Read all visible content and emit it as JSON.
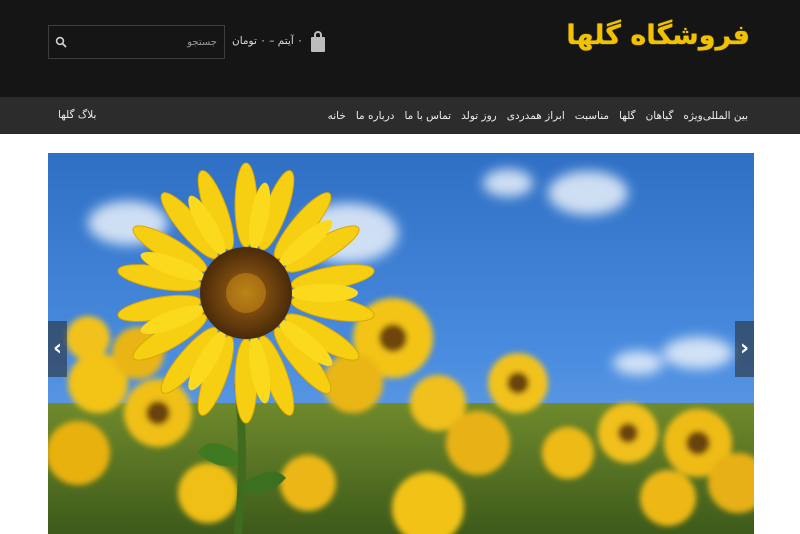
{
  "header": {
    "logo_text": "فروشگاه گلها",
    "cart_text": "۰ آیتم – ۰ تومان",
    "search_placeholder": "جستجو"
  },
  "nav": {
    "items": [
      "خانه",
      "درباره ما",
      "تماس با ما",
      "روز تولد",
      "ابراز همدردی",
      "مناسبت",
      "گلها",
      "گیاهان",
      "ویژه",
      "بین المللی"
    ],
    "blog_link": "بلاگ گلها"
  },
  "slider": {
    "prev_arrow": "‹",
    "next_arrow": "›",
    "image": "sunflower-field"
  },
  "colors": {
    "topbar": "#151515",
    "navbar": "#2c2c2c",
    "logo": "#f2c200",
    "sky": "#3576c9"
  }
}
